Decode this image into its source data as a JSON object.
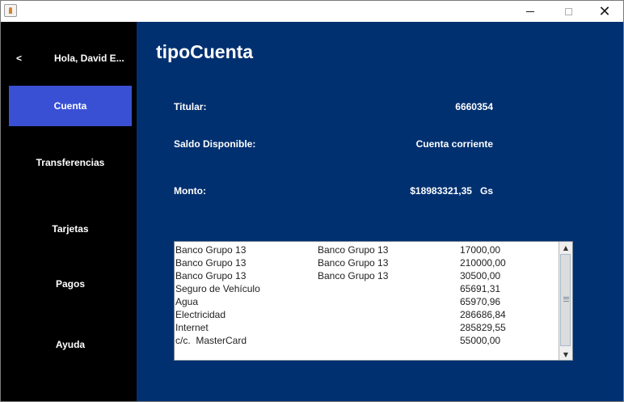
{
  "titlebar": {
    "app_icon": "java-cup-icon",
    "minimize_icon": "minimize-icon",
    "maximize_icon": "maximize-icon",
    "close_icon": "close-icon",
    "close_glyph": "✕"
  },
  "sidebar": {
    "back_label": "<",
    "greeting": "Hola, David E...",
    "items": [
      {
        "label": "Cuenta",
        "active": true
      },
      {
        "label": "Transferencias",
        "active": false
      },
      {
        "label": "Tarjetas",
        "active": false
      },
      {
        "label": "Pagos",
        "active": false
      },
      {
        "label": "Ayuda",
        "active": false
      }
    ],
    "active_color": "#3a50d4",
    "background": "#000000"
  },
  "main": {
    "title": "tipoCuenta",
    "background": "#003070",
    "fields": [
      {
        "label": "Titular:",
        "value": "6660354"
      },
      {
        "label": "Saldo Disponible:",
        "value": "Cuenta corriente"
      },
      {
        "label": "Monto:",
        "value": "$18983321,35   Gs"
      }
    ],
    "transactions": [
      {
        "desc": "Banco Grupo 13",
        "dest": "Banco Grupo 13",
        "amount": "17000,00"
      },
      {
        "desc": "Banco Grupo 13",
        "dest": "Banco Grupo 13",
        "amount": "210000,00"
      },
      {
        "desc": "Banco Grupo 13",
        "dest": "Banco Grupo 13",
        "amount": "30500,00"
      },
      {
        "desc": "Seguro de Vehículo",
        "dest": "",
        "amount": "65691,31"
      },
      {
        "desc": "Agua",
        "dest": "",
        "amount": "65970,96"
      },
      {
        "desc": "Electricidad",
        "dest": "",
        "amount": "286686,84"
      },
      {
        "desc": "Internet",
        "dest": "",
        "amount": "285829,55"
      },
      {
        "desc": "c/c.  MasterCard",
        "dest": "",
        "amount": "55000,00"
      }
    ],
    "scroll_up_glyph": "▲",
    "scroll_down_glyph": "▼"
  }
}
